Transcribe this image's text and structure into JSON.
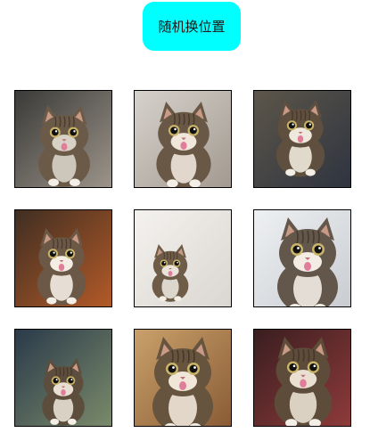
{
  "toolbar": {
    "shuffle_label": "随机换位置"
  },
  "grid": {
    "tiles": [
      {
        "name": "cat-photo-1",
        "bg": [
          "#3a3a38",
          "#9c948a"
        ],
        "fur": "#6b5a48",
        "accent": "#d8d2c6"
      },
      {
        "name": "cat-photo-2",
        "bg": [
          "#d6d2cc",
          "#a39a90"
        ],
        "fur": "#6a5846",
        "accent": "#f0e6da"
      },
      {
        "name": "cat-photo-3",
        "bg": [
          "#5c564a",
          "#2f3440"
        ],
        "fur": "#5f4f3e",
        "accent": "#efe8dc"
      },
      {
        "name": "cat-photo-4",
        "bg": [
          "#3f2e22",
          "#b35a28"
        ],
        "fur": "#6b5846",
        "accent": "#f4ede4"
      },
      {
        "name": "cat-photo-5",
        "bg": [
          "#f4f2ef",
          "#dad6d0"
        ],
        "fur": "#6e5c48",
        "accent": "#e9e3da"
      },
      {
        "name": "cat-photo-6",
        "bg": [
          "#eef0f2",
          "#c9cdd2"
        ],
        "fur": "#62574a",
        "accent": "#f2ece4"
      },
      {
        "name": "cat-photo-7",
        "bg": [
          "#2a3a4a",
          "#7a8a6a"
        ],
        "fur": "#5c4d3c",
        "accent": "#e8e0d4"
      },
      {
        "name": "cat-photo-8",
        "bg": [
          "#c9a06a",
          "#8a5c36"
        ],
        "fur": "#66543f",
        "accent": "#efe6d8"
      },
      {
        "name": "cat-photo-9",
        "bg": [
          "#3a1e20",
          "#8e3a3a"
        ],
        "fur": "#5e4c3a",
        "accent": "#e9e0d2"
      }
    ]
  }
}
